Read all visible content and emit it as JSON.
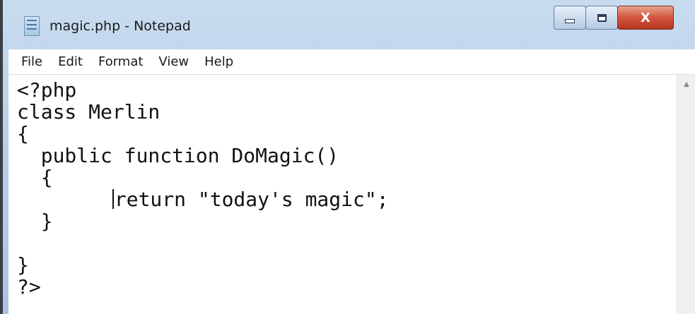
{
  "window": {
    "title": "magic.php - Notepad"
  },
  "caption_buttons": {
    "minimize_icon": "minimize-icon",
    "maximize_icon": "maximize-icon",
    "close_label": "X"
  },
  "menu": {
    "items": [
      "File",
      "Edit",
      "Format",
      "View",
      "Help"
    ]
  },
  "editor": {
    "lines": [
      "<?php",
      "class Merlin",
      "{",
      "  public function DoMagic()",
      "  {",
      "        return \"today's magic\";",
      "  }",
      "",
      "}",
      "?>"
    ],
    "caret_line": 6,
    "caret_prefix": "        "
  },
  "scrollbar": {
    "up_arrow": "▲"
  },
  "colors": {
    "title_bar": "#b9d1ea",
    "close_button": "#d3553d",
    "text": "#111111"
  }
}
